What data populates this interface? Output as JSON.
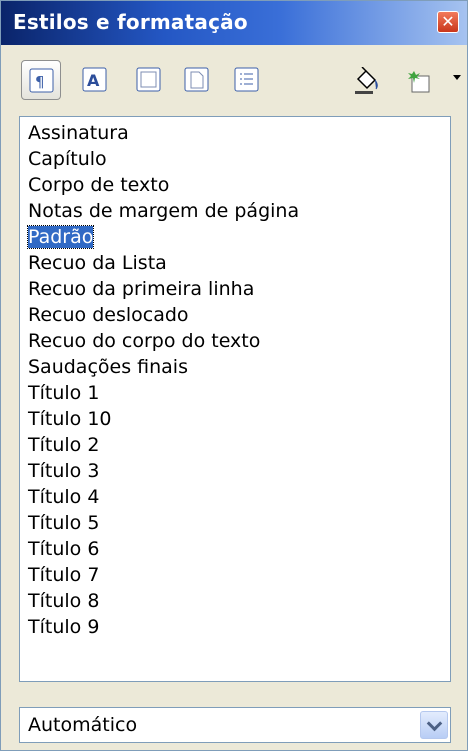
{
  "window": {
    "title": "Estilos e formatação"
  },
  "toolbar": {
    "buttons": [
      {
        "name": "paragraph-styles",
        "icon": "paragraph-styles-icon",
        "active": true
      },
      {
        "name": "character-styles",
        "icon": "character-styles-icon",
        "active": false
      },
      {
        "name": "frame-styles",
        "icon": "frame-styles-icon",
        "active": false
      },
      {
        "name": "page-styles",
        "icon": "page-styles-icon",
        "active": false
      },
      {
        "name": "list-styles",
        "icon": "list-styles-icon",
        "active": false
      },
      {
        "name": "fill-format-mode",
        "icon": "paint-bucket-icon",
        "active": false
      },
      {
        "name": "new-style-from-selection",
        "icon": "new-style-icon",
        "active": false
      }
    ]
  },
  "styles": {
    "items": [
      "Assinatura",
      "Capítulo",
      "Corpo de texto",
      "Notas de margem de página",
      "Padrão",
      "Recuo da Lista",
      "Recuo da primeira linha",
      "Recuo deslocado",
      "Recuo do corpo do texto",
      "Saudações finais",
      "Título 1",
      "Título 10",
      "Título 2",
      "Título 3",
      "Título 4",
      "Título 5",
      "Título 6",
      "Título 7",
      "Título 8",
      "Título 9"
    ],
    "selected": "Padrão"
  },
  "filter": {
    "value": "Automático"
  },
  "colors": {
    "titlebar": "#2457c4",
    "selection": "#316ac5",
    "close": "#c9361b"
  }
}
